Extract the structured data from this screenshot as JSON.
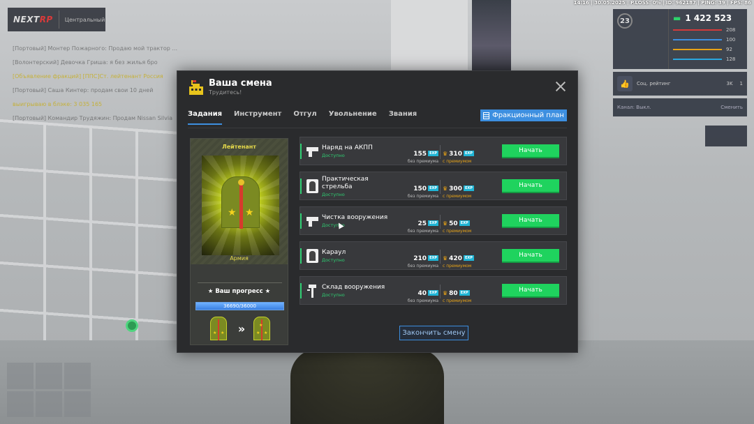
{
  "hud": {
    "status_line": "14:16 | 30.05.2025 | P.LOSS: 0% | ID: 962187 | PING: 39 | FPS: 86",
    "logo_prefix": "NEXT",
    "logo_suffix": "RP",
    "server": "Центральный",
    "money": "1 422 523",
    "level": "23",
    "health": "208",
    "armor": "100",
    "hunger": "92",
    "thirst": "128",
    "social_label": "Соц. рейтинг",
    "social_value": "3K",
    "social_count": "1",
    "channel_label": "Канал: Выкл.",
    "channel_switch": "Сменить"
  },
  "chat": [
    "[Портовый] Монтер Пожарного: Продаю мой трактор ...",
    "[Волонтерский] Девочка Гриша: я без жилья бро",
    "[Объявление фракций] [ППС]Ст. лейтенант Россия",
    "[Портовый] Саша Кинтер: продам свои 10 дней",
    "выигрываю в блэке: 3 035 165",
    "[Портовый] Командир Трудяжин: Продам Nissan Silvia"
  ],
  "modal": {
    "title": "Ваша смена",
    "subtitle": "Трудитесь!",
    "tabs": [
      "Задания",
      "Инструмент",
      "Отгул",
      "Увольнение",
      "Звания"
    ],
    "plan_button": "Фракционный план",
    "rank": {
      "name": "Лейтенант",
      "branch": "Армия",
      "progress_label": "★ Ваш прогресс ★",
      "progress_text": "36690/36000",
      "progress_fraction": 1.0
    },
    "tasks": [
      {
        "name": "Наряд на АКПП",
        "status": "Доступно",
        "icon": "gun-icon",
        "exp": "155",
        "exp_premium": "310"
      },
      {
        "name": "Практическая стрельба",
        "status": "Доступно",
        "icon": "target-icon",
        "exp": "150",
        "exp_premium": "300"
      },
      {
        "name": "Чистка вооружения",
        "status": "Доступно",
        "icon": "gun-icon",
        "exp": "25",
        "exp_premium": "50"
      },
      {
        "name": "Караул",
        "status": "Доступно",
        "icon": "target-icon",
        "exp": "210",
        "exp_premium": "420"
      },
      {
        "name": "Склад вооружения",
        "status": "Доступно",
        "icon": "wrench-icon",
        "exp": "40",
        "exp_premium": "80"
      }
    ],
    "exp_tag": "EXP",
    "no_premium": "без премиума",
    "with_premium": "с премиумом",
    "start_label": "Начать",
    "end_shift": "Закончить смену"
  },
  "colors": {
    "accent_blue": "#3d8fe0",
    "accent_green": "#1fd35e",
    "rank_yellow": "#e5d94a",
    "premium_orange": "#e8a317"
  }
}
